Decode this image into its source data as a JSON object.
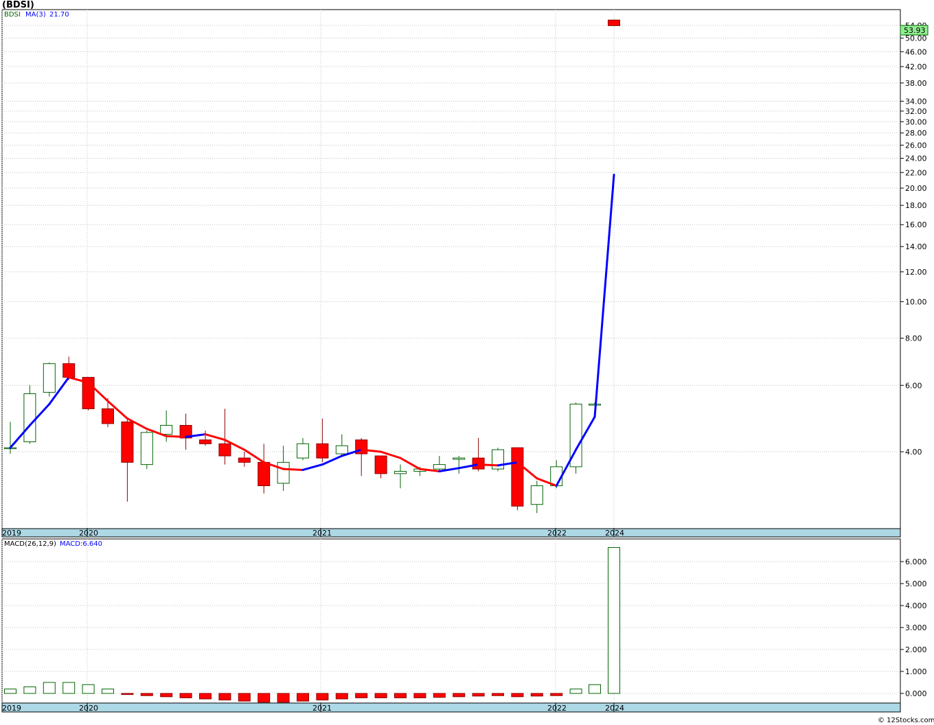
{
  "chart_title": "(BDSI)",
  "footer": "© 12Stocks.com",
  "colors": {
    "up_candle_stroke": "#006400",
    "down_candle_fill": "#ff0000",
    "ma_up": "#0000ff",
    "ma_down": "#ff0000",
    "date_bar": "#add8e6",
    "grid": "#c0c0c0",
    "price_badge": "#90ee90",
    "legend_symbol": "#006400",
    "legend_ma": "#0000ff"
  },
  "price_panel": {
    "symbol_label": "BDSI",
    "ma_label": "MA(3)",
    "ma_value": "21.70",
    "last_price_badge": "53.93",
    "y_ticks": [
      "54.00",
      "50.00",
      "46.00",
      "42.00",
      "38.00",
      "34.00",
      "32.00",
      "30.00",
      "28.00",
      "26.00",
      "24.00",
      "22.00",
      "20.00",
      "18.00",
      "16.00",
      "14.00",
      "12.00",
      "10.00",
      "8.00",
      "6.00",
      "4.00"
    ],
    "date_labels": [
      "2019",
      "2020",
      "2021",
      "2022",
      "2024"
    ]
  },
  "macd_panel": {
    "label": "MACD(26,12,9)",
    "value_label": "MACD:6.640",
    "y_ticks": [
      "6.000",
      "5.000",
      "4.000",
      "3.000",
      "2.000",
      "1.000",
      "0.000"
    ],
    "date_labels": [
      "2019",
      "2020",
      "2021",
      "2022",
      "2024"
    ]
  },
  "chart_data": {
    "type": "candlestick",
    "scale": "log",
    "ylim": [
      2.75,
      56
    ],
    "x_labels": [
      "2019",
      "2020",
      "2021",
      "2022",
      "2024"
    ],
    "candles": [
      {
        "o": 4.1,
        "h": 4.8,
        "l": 3.95,
        "c": 4.1
      },
      {
        "o": 4.25,
        "h": 6.0,
        "l": 4.2,
        "c": 5.7
      },
      {
        "o": 5.75,
        "h": 6.9,
        "l": 5.6,
        "c": 6.85
      },
      {
        "o": 6.85,
        "h": 7.15,
        "l": 6.2,
        "c": 6.3
      },
      {
        "o": 6.3,
        "h": 6.3,
        "l": 5.15,
        "c": 5.2
      },
      {
        "o": 5.2,
        "h": 5.55,
        "l": 4.65,
        "c": 4.75
      },
      {
        "o": 4.8,
        "h": 4.9,
        "l": 2.95,
        "c": 3.75
      },
      {
        "o": 3.7,
        "h": 4.55,
        "l": 3.6,
        "c": 4.5
      },
      {
        "o": 4.45,
        "h": 5.15,
        "l": 4.25,
        "c": 4.7
      },
      {
        "o": 4.7,
        "h": 5.05,
        "l": 4.05,
        "c": 4.35
      },
      {
        "o": 4.3,
        "h": 4.55,
        "l": 4.15,
        "c": 4.2
      },
      {
        "o": 4.2,
        "h": 5.2,
        "l": 3.7,
        "c": 3.9
      },
      {
        "o": 3.85,
        "h": 4.0,
        "l": 3.65,
        "c": 3.75
      },
      {
        "o": 3.75,
        "h": 4.2,
        "l": 3.1,
        "c": 3.25
      },
      {
        "o": 3.3,
        "h": 4.15,
        "l": 3.15,
        "c": 3.75
      },
      {
        "o": 3.85,
        "h": 4.35,
        "l": 3.8,
        "c": 4.2
      },
      {
        "o": 4.2,
        "h": 4.9,
        "l": 3.75,
        "c": 3.85
      },
      {
        "o": 3.95,
        "h": 4.45,
        "l": 3.9,
        "c": 4.15
      },
      {
        "o": 4.3,
        "h": 4.35,
        "l": 3.45,
        "c": 3.95
      },
      {
        "o": 3.9,
        "h": 3.9,
        "l": 3.4,
        "c": 3.5
      },
      {
        "o": 3.5,
        "h": 3.7,
        "l": 3.2,
        "c": 3.55
      },
      {
        "o": 3.55,
        "h": 3.65,
        "l": 3.45,
        "c": 3.6
      },
      {
        "o": 3.6,
        "h": 3.9,
        "l": 3.55,
        "c": 3.7
      },
      {
        "o": 3.82,
        "h": 3.9,
        "l": 3.5,
        "c": 3.85
      },
      {
        "o": 3.85,
        "h": 4.35,
        "l": 3.55,
        "c": 3.6
      },
      {
        "o": 3.6,
        "h": 4.1,
        "l": 3.55,
        "c": 4.05
      },
      {
        "o": 4.1,
        "h": 4.1,
        "l": 2.8,
        "c": 2.87
      },
      {
        "o": 2.9,
        "h": 3.35,
        "l": 2.75,
        "c": 3.25
      },
      {
        "o": 3.25,
        "h": 3.8,
        "l": 3.2,
        "c": 3.65
      },
      {
        "o": 3.65,
        "h": 5.4,
        "l": 3.5,
        "c": 5.35
      },
      {
        "o": 5.35,
        "h": 5.4,
        "l": 5.3,
        "c": 5.35
      },
      {
        "o": 55.8,
        "h": 56.0,
        "l": 53.9,
        "c": 53.93
      }
    ],
    "ma3": [
      4.1,
      4.7,
      5.35,
      6.3,
      6.1,
      5.45,
      4.9,
      4.6,
      4.4,
      4.38,
      4.45,
      4.3,
      4.05,
      3.75,
      3.6,
      3.58,
      3.7,
      3.9,
      4.05,
      4.0,
      3.85,
      3.6,
      3.55,
      3.62,
      3.7,
      3.68,
      3.75,
      3.4,
      3.25,
      4.05,
      4.95,
      21.7
    ],
    "macd_histogram": [
      0.2,
      0.3,
      0.5,
      0.5,
      0.4,
      0.2,
      -0.05,
      -0.1,
      -0.15,
      -0.2,
      -0.25,
      -0.3,
      -0.35,
      -0.4,
      -0.4,
      -0.35,
      -0.3,
      -0.25,
      -0.2,
      -0.2,
      -0.2,
      -0.2,
      -0.18,
      -0.15,
      -0.12,
      -0.1,
      -0.15,
      -0.12,
      -0.1,
      0.2,
      0.4,
      6.64
    ]
  }
}
